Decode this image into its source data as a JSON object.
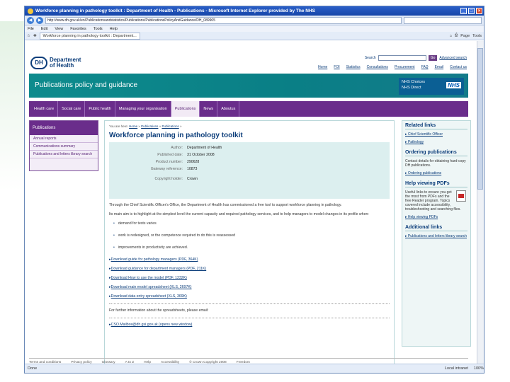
{
  "window": {
    "title": "Workforce planning in pathology toolkit : Department of Health - Publications - Microsoft Internet Explorer provided by The NHS",
    "address": "http://www.dh.gov.uk/en/Publicationsandstatistics/Publications/PublicationsPolicyAndGuidance/DH_089905",
    "tab": "Workforce planning in pathology toolkit : Department..."
  },
  "menu": [
    "File",
    "Edit",
    "View",
    "Favorites",
    "Tools",
    "Help"
  ],
  "ie_tools": [
    "Page",
    "Tools"
  ],
  "status": {
    "left": "Done",
    "zone": "Local intranet",
    "zoom": "100%"
  },
  "site": {
    "logo_line1": "Department",
    "logo_line2": "of Health",
    "logo_mark": "DH",
    "search_label": "Search",
    "search_go": "Go",
    "advanced_search": "Advanced search",
    "toplinks": [
      "Home",
      "FOI",
      "Statistics",
      "Consultations",
      "Procurement",
      "FAQ",
      "Email",
      "Contact us"
    ],
    "banner_title": "Publications policy and guidance",
    "nhs_choices": "NHS Choices",
    "nhs_direct": "NHS Direct",
    "nhs_logo": "NHS",
    "nav": [
      "Health care",
      "Social care",
      "Public health",
      "Managing your organisation",
      "Publications",
      "News",
      "Aboutus"
    ]
  },
  "leftnav": {
    "head": "Publications",
    "items": [
      "Annual reports",
      "Communications summary",
      "Publications and letters library search"
    ]
  },
  "main": {
    "breadcrumb_prefix": "You are here:",
    "breadcrumbs": [
      "Home",
      "Publications",
      "Publications"
    ],
    "title": "Workforce planning in pathology toolkit",
    "meta": [
      {
        "k": "Author:",
        "v": "Department of Health"
      },
      {
        "k": "Published date:",
        "v": "31 October 2008"
      },
      {
        "k": "Product number:",
        "v": "290628"
      },
      {
        "k": "Gateway reference:",
        "v": "10873"
      },
      {
        "k": "Copyright holder:",
        "v": "Crown"
      }
    ],
    "intro": "Through the Chief Scientific Officer's Office, the Department of Health has commissioned a free tool to support workforce planning in pathology.",
    "intro2": "Its main aim is to highlight at the simplest level the current capacity and required pathology services, and to help managers to model changes in its profile when:",
    "bullets": [
      "demand for tests varies",
      "work is redesigned, or the competence required to do this is reassessed",
      "improvements in productivity are achieved."
    ],
    "downloads": [
      "Download guide for pathology managers (PDF, 364K)",
      "Download guidance for department managers (PDF, 211K)",
      "Download How to use the model (PDF, 1232K)",
      "Download main model spreadsheet (XLS, 2697K)",
      "Download data entry spreadsheet (XLS, 369K)"
    ],
    "further": "For further information about the spreadsheets, please email:",
    "email": "CSO.Mailbox@dh.gsi.gov.uk (opens new window)"
  },
  "right": {
    "related_head": "Related links",
    "related": [
      "Chief Scientific Officer",
      "Pathology"
    ],
    "ordering_head": "Ordering publications",
    "ordering_text": "Contact details for obtaining hard-copy DH publications.",
    "ordering_link": "Ordering publications",
    "pdf_head": "Help viewing PDFs",
    "pdf_text": "Useful links to ensure you get the most from PDFs and the free Reader program. Topics covered include accessibility, troubleshooting and searching files.",
    "pdf_link": "Help viewing PDFs",
    "additional_head": "Additional links",
    "additional": [
      "Publications and letters library search"
    ]
  },
  "footer": [
    "Terms and conditions",
    "Privacy policy",
    "Glossary",
    "A to Z",
    "Help",
    "Accessibility",
    "© Crown Copyright 2008",
    "Freedom"
  ]
}
